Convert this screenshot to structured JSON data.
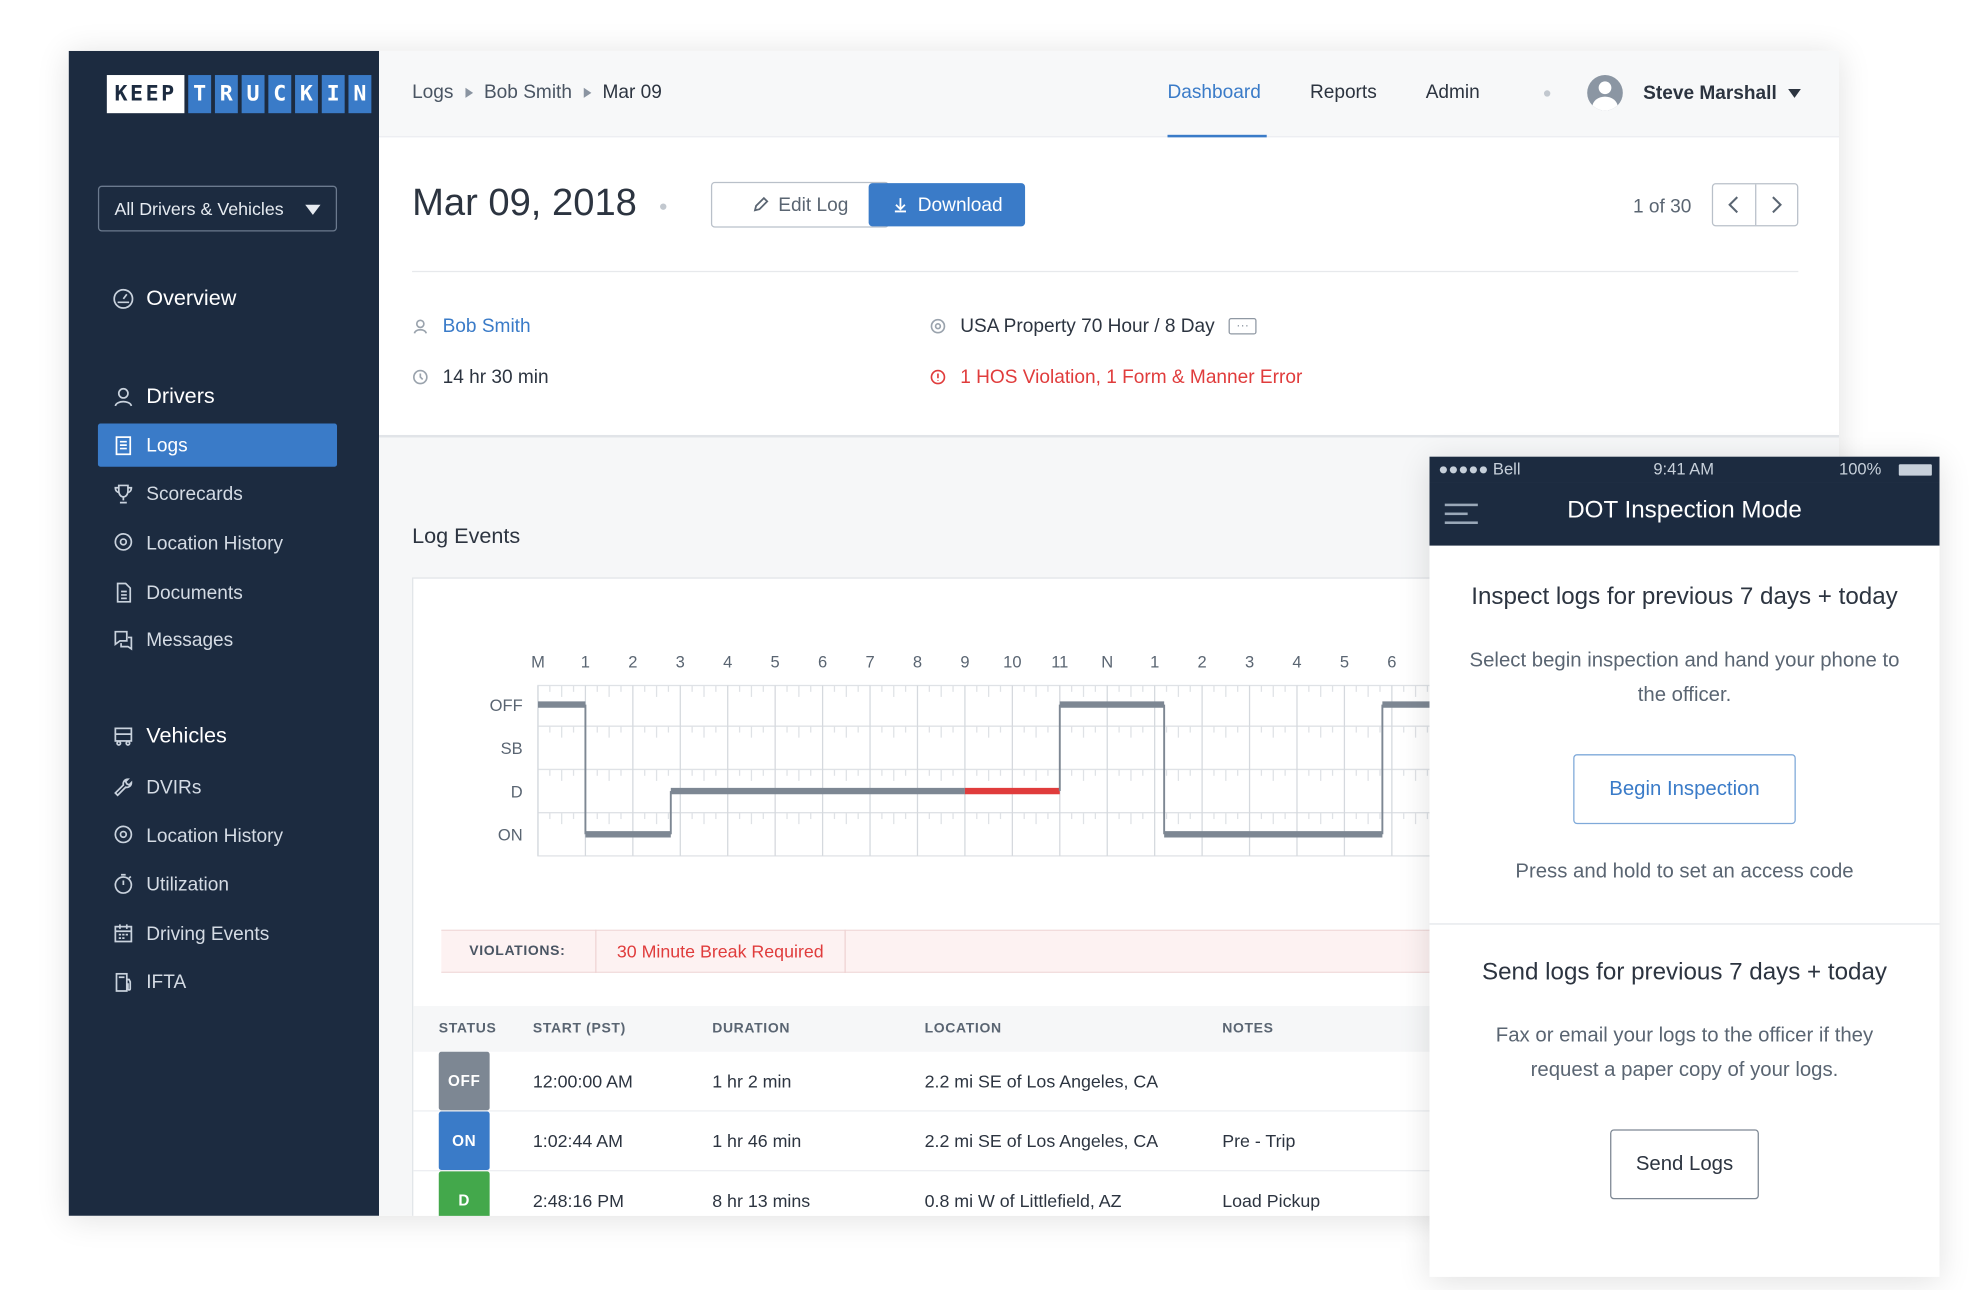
{
  "logo": {
    "keep": "KEEP",
    "truckin": [
      "T",
      "R",
      "U",
      "C",
      "K",
      "I",
      "N"
    ]
  },
  "sidebar": {
    "filter_label": "All Drivers & Vehicles",
    "overview": "Overview",
    "drivers_section": "Drivers",
    "driver_items": [
      "Logs",
      "Scorecards",
      "Location History",
      "Documents",
      "Messages"
    ],
    "vehicles_section": "Vehicles",
    "vehicle_items": [
      "DVIRs",
      "Location History",
      "Utilization",
      "Driving Events",
      "IFTA"
    ],
    "active_item": "Logs"
  },
  "breadcrumb": [
    "Logs",
    "Bob Smith",
    "Mar 09"
  ],
  "topnav": {
    "dashboard": "Dashboard",
    "reports": "Reports",
    "admin": "Admin",
    "user": "Steve Marshall"
  },
  "header": {
    "title": "Mar 09, 2018",
    "edit_label": "Edit Log",
    "download_label": "Download",
    "pager": "1 of 30"
  },
  "meta": {
    "driver": "Bob Smith",
    "duration": "14 hr 30 min",
    "ruleset": "USA Property 70 Hour / 8 Day",
    "more": "···",
    "violations": "1 HOS Violation, 1 Form & Manner Error"
  },
  "section_title": "Log Events",
  "chart_data": {
    "type": "line",
    "hour_labels": [
      "M",
      "1",
      "2",
      "3",
      "4",
      "5",
      "6",
      "7",
      "8",
      "9",
      "10",
      "11",
      "N",
      "1",
      "2",
      "3",
      "4",
      "5",
      "6"
    ],
    "status_rows": [
      "OFF",
      "SB",
      "D",
      "ON"
    ],
    "segments": [
      {
        "status": "OFF",
        "start": 0,
        "end": 1.0
      },
      {
        "status": "ON",
        "start": 1.0,
        "end": 2.8
      },
      {
        "status": "D",
        "start": 2.8,
        "end": 9.0
      },
      {
        "status": "D",
        "start": 9.0,
        "end": 11.0,
        "violation": true
      },
      {
        "status": "OFF",
        "start": 11.0,
        "end": 13.2
      },
      {
        "status": "ON",
        "start": 13.2,
        "end": 17.8
      },
      {
        "status": "OFF",
        "start": 17.8,
        "end": 19.0
      }
    ],
    "colors": {
      "line": "#7d8793",
      "violation": "#e03c3c",
      "grid": "#dfe2e6"
    }
  },
  "violations_bar": {
    "label": "VIOLATIONS:",
    "text": "30 Minute Break Required"
  },
  "table": {
    "headers": [
      "STATUS",
      "START (PST)",
      "DURATION",
      "LOCATION",
      "NOTES"
    ],
    "rows": [
      {
        "status": "OFF",
        "color": "#7d8793",
        "start": "12:00:00 AM",
        "duration": "1 hr 2 min",
        "location": "2.2 mi SE of Los Angeles, CA",
        "notes": ""
      },
      {
        "status": "ON",
        "color": "#3a7bc8",
        "start": "1:02:44 AM",
        "duration": "1 hr 46 min",
        "location": "2.2 mi SE of Los Angeles, CA",
        "notes": "Pre - Trip"
      },
      {
        "status": "D",
        "color": "#43a84b",
        "start": "2:48:16 PM",
        "duration": "8 hr 13 mins",
        "location": "0.8 mi W of Littlefield, AZ",
        "notes": "Load Pickup"
      }
    ]
  },
  "phone": {
    "carrier": "●●●●● Bell",
    "time": "9:41 AM",
    "battery": "100%",
    "title": "DOT Inspection Mode",
    "inspect_heading": "Inspect logs for previous 7 days + today",
    "inspect_text": "Select begin inspection and hand your phone to the officer.",
    "begin_label": "Begin Inspection",
    "hold_text": "Press and hold to set an access code",
    "send_heading": "Send logs for previous 7 days + today",
    "send_text": "Fax or email your logs to the officer if they request a paper copy of your logs.",
    "send_label": "Send Logs"
  }
}
